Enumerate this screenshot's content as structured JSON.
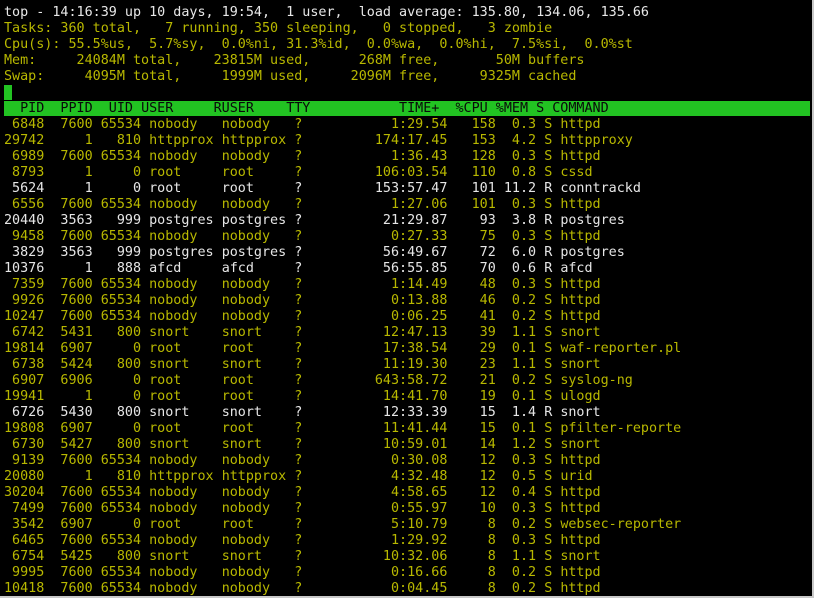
{
  "summary": {
    "uptime_line": "top - 14:16:39 up 10 days, 19:54,  1 user,  load average: 135.80, 134.06, 135.66",
    "tasks_line": "Tasks: 360 total,   7 running, 350 sleeping,   0 stopped,   3 zombie",
    "cpu_line": "Cpu(s): 55.5%us,  5.7%sy,  0.0%ni, 31.3%id,  0.0%wa,  0.0%hi,  7.5%si,  0.0%st",
    "mem_line": "Mem:     24084M total,    23815M used,      268M free,       50M buffers",
    "swap_line": "Swap:     4095M total,     1999M used,     2096M free,     9325M cached"
  },
  "columns": [
    "PID",
    "PPID",
    "UID",
    "USER",
    "RUSER",
    "TTY",
    "TIME+",
    "%CPU",
    "%MEM",
    "S",
    "COMMAND"
  ],
  "colors": {
    "terminal_bg": "#000000",
    "sleeping_text": "#b8b800",
    "running_text": "#e6e6e6",
    "header_bar": "#22c322"
  },
  "processes": [
    {
      "pid": "6848",
      "ppid": "7600",
      "uid": "65534",
      "user": "nobody",
      "ruser": "nobody",
      "tty": "?",
      "time": "1:29.54",
      "cpu": "158",
      "mem": "0.3",
      "state": "S",
      "command": "httpd"
    },
    {
      "pid": "29742",
      "ppid": "1",
      "uid": "810",
      "user": "httpprox",
      "ruser": "httpprox",
      "tty": "?",
      "time": "174:17.45",
      "cpu": "153",
      "mem": "4.2",
      "state": "S",
      "command": "httpproxy"
    },
    {
      "pid": "6989",
      "ppid": "7600",
      "uid": "65534",
      "user": "nobody",
      "ruser": "nobody",
      "tty": "?",
      "time": "1:36.43",
      "cpu": "128",
      "mem": "0.3",
      "state": "S",
      "command": "httpd"
    },
    {
      "pid": "8793",
      "ppid": "1",
      "uid": "0",
      "user": "root",
      "ruser": "root",
      "tty": "?",
      "time": "106:03.54",
      "cpu": "110",
      "mem": "0.8",
      "state": "S",
      "command": "cssd"
    },
    {
      "pid": "5624",
      "ppid": "1",
      "uid": "0",
      "user": "root",
      "ruser": "root",
      "tty": "?",
      "time": "153:57.47",
      "cpu": "101",
      "mem": "11.2",
      "state": "R",
      "command": "conntrackd"
    },
    {
      "pid": "6556",
      "ppid": "7600",
      "uid": "65534",
      "user": "nobody",
      "ruser": "nobody",
      "tty": "?",
      "time": "1:27.06",
      "cpu": "101",
      "mem": "0.3",
      "state": "S",
      "command": "httpd"
    },
    {
      "pid": "20440",
      "ppid": "3563",
      "uid": "999",
      "user": "postgres",
      "ruser": "postgres",
      "tty": "?",
      "time": "21:29.87",
      "cpu": "93",
      "mem": "3.8",
      "state": "R",
      "command": "postgres"
    },
    {
      "pid": "9458",
      "ppid": "7600",
      "uid": "65534",
      "user": "nobody",
      "ruser": "nobody",
      "tty": "?",
      "time": "0:27.33",
      "cpu": "75",
      "mem": "0.3",
      "state": "S",
      "command": "httpd"
    },
    {
      "pid": "3829",
      "ppid": "3563",
      "uid": "999",
      "user": "postgres",
      "ruser": "postgres",
      "tty": "?",
      "time": "56:49.67",
      "cpu": "72",
      "mem": "6.0",
      "state": "R",
      "command": "postgres"
    },
    {
      "pid": "10376",
      "ppid": "1",
      "uid": "888",
      "user": "afcd",
      "ruser": "afcd",
      "tty": "?",
      "time": "56:55.85",
      "cpu": "70",
      "mem": "0.6",
      "state": "R",
      "command": "afcd"
    },
    {
      "pid": "7359",
      "ppid": "7600",
      "uid": "65534",
      "user": "nobody",
      "ruser": "nobody",
      "tty": "?",
      "time": "1:14.49",
      "cpu": "48",
      "mem": "0.3",
      "state": "S",
      "command": "httpd"
    },
    {
      "pid": "9926",
      "ppid": "7600",
      "uid": "65534",
      "user": "nobody",
      "ruser": "nobody",
      "tty": "?",
      "time": "0:13.88",
      "cpu": "46",
      "mem": "0.2",
      "state": "S",
      "command": "httpd"
    },
    {
      "pid": "10247",
      "ppid": "7600",
      "uid": "65534",
      "user": "nobody",
      "ruser": "nobody",
      "tty": "?",
      "time": "0:06.25",
      "cpu": "41",
      "mem": "0.2",
      "state": "S",
      "command": "httpd"
    },
    {
      "pid": "6742",
      "ppid": "5431",
      "uid": "800",
      "user": "snort",
      "ruser": "snort",
      "tty": "?",
      "time": "12:47.13",
      "cpu": "39",
      "mem": "1.1",
      "state": "S",
      "command": "snort"
    },
    {
      "pid": "19814",
      "ppid": "6907",
      "uid": "0",
      "user": "root",
      "ruser": "root",
      "tty": "?",
      "time": "17:38.54",
      "cpu": "29",
      "mem": "0.1",
      "state": "S",
      "command": "waf-reporter.pl"
    },
    {
      "pid": "6738",
      "ppid": "5424",
      "uid": "800",
      "user": "snort",
      "ruser": "snort",
      "tty": "?",
      "time": "11:19.30",
      "cpu": "23",
      "mem": "1.1",
      "state": "S",
      "command": "snort"
    },
    {
      "pid": "6907",
      "ppid": "6906",
      "uid": "0",
      "user": "root",
      "ruser": "root",
      "tty": "?",
      "time": "643:58.72",
      "cpu": "21",
      "mem": "0.2",
      "state": "S",
      "command": "syslog-ng"
    },
    {
      "pid": "19941",
      "ppid": "1",
      "uid": "0",
      "user": "root",
      "ruser": "root",
      "tty": "?",
      "time": "14:41.70",
      "cpu": "19",
      "mem": "0.1",
      "state": "S",
      "command": "ulogd"
    },
    {
      "pid": "6726",
      "ppid": "5430",
      "uid": "800",
      "user": "snort",
      "ruser": "snort",
      "tty": "?",
      "time": "12:33.39",
      "cpu": "15",
      "mem": "1.4",
      "state": "R",
      "command": "snort"
    },
    {
      "pid": "19808",
      "ppid": "6907",
      "uid": "0",
      "user": "root",
      "ruser": "root",
      "tty": "?",
      "time": "11:41.44",
      "cpu": "15",
      "mem": "0.1",
      "state": "S",
      "command": "pfilter-reporte"
    },
    {
      "pid": "6730",
      "ppid": "5427",
      "uid": "800",
      "user": "snort",
      "ruser": "snort",
      "tty": "?",
      "time": "10:59.01",
      "cpu": "14",
      "mem": "1.2",
      "state": "S",
      "command": "snort"
    },
    {
      "pid": "9139",
      "ppid": "7600",
      "uid": "65534",
      "user": "nobody",
      "ruser": "nobody",
      "tty": "?",
      "time": "0:30.08",
      "cpu": "12",
      "mem": "0.3",
      "state": "S",
      "command": "httpd"
    },
    {
      "pid": "20080",
      "ppid": "1",
      "uid": "810",
      "user": "httpprox",
      "ruser": "httpprox",
      "tty": "?",
      "time": "4:32.48",
      "cpu": "12",
      "mem": "0.5",
      "state": "S",
      "command": "urid"
    },
    {
      "pid": "30204",
      "ppid": "7600",
      "uid": "65534",
      "user": "nobody",
      "ruser": "nobody",
      "tty": "?",
      "time": "4:58.65",
      "cpu": "12",
      "mem": "0.4",
      "state": "S",
      "command": "httpd"
    },
    {
      "pid": "7499",
      "ppid": "7600",
      "uid": "65534",
      "user": "nobody",
      "ruser": "nobody",
      "tty": "?",
      "time": "0:55.97",
      "cpu": "10",
      "mem": "0.3",
      "state": "S",
      "command": "httpd"
    },
    {
      "pid": "3542",
      "ppid": "6907",
      "uid": "0",
      "user": "root",
      "ruser": "root",
      "tty": "?",
      "time": "5:10.79",
      "cpu": "8",
      "mem": "0.2",
      "state": "S",
      "command": "websec-reporter"
    },
    {
      "pid": "6465",
      "ppid": "7600",
      "uid": "65534",
      "user": "nobody",
      "ruser": "nobody",
      "tty": "?",
      "time": "1:29.92",
      "cpu": "8",
      "mem": "0.3",
      "state": "S",
      "command": "httpd"
    },
    {
      "pid": "6754",
      "ppid": "5425",
      "uid": "800",
      "user": "snort",
      "ruser": "snort",
      "tty": "?",
      "time": "10:32.06",
      "cpu": "8",
      "mem": "1.1",
      "state": "S",
      "command": "snort"
    },
    {
      "pid": "9995",
      "ppid": "7600",
      "uid": "65534",
      "user": "nobody",
      "ruser": "nobody",
      "tty": "?",
      "time": "0:16.66",
      "cpu": "8",
      "mem": "0.2",
      "state": "S",
      "command": "httpd"
    },
    {
      "pid": "10418",
      "ppid": "7600",
      "uid": "65534",
      "user": "nobody",
      "ruser": "nobody",
      "tty": "?",
      "time": "0:04.45",
      "cpu": "8",
      "mem": "0.2",
      "state": "S",
      "command": "httpd"
    }
  ]
}
